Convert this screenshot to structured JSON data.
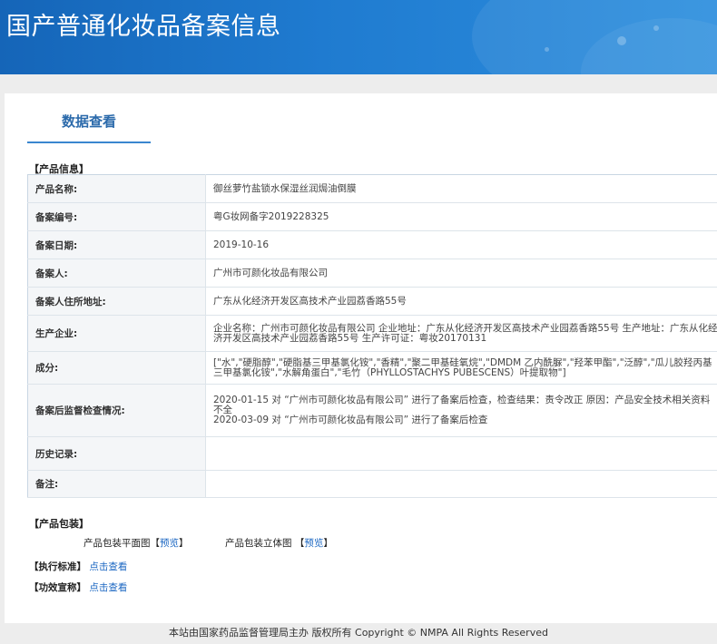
{
  "header": {
    "title": "国产普通化妆品备案信息"
  },
  "tab": {
    "label": "数据查看"
  },
  "product_info": {
    "section_title": "【产品信息】",
    "rows": [
      {
        "label": "产品名称:",
        "value": "御丝萝竹盐锁水保湿丝润焗油倒膜"
      },
      {
        "label": "备案编号:",
        "value": "粤G妆网备字2019228325"
      },
      {
        "label": "备案日期:",
        "value": "2019-10-16"
      },
      {
        "label": "备案人:",
        "value": "广州市可颜化妆品有限公司"
      },
      {
        "label": "备案人住所地址:",
        "value": "广东从化经济开发区高技术产业园荔香路55号"
      },
      {
        "label": "生产企业:",
        "value": "企业名称：广州市可颜化妆品有限公司 企业地址：广东从化经济开发区高技术产业园荔香路55号 生产地址：广东从化经济开发区高技术产业园荔香路55号 生产许可证：粤妆20170131"
      },
      {
        "label": "成分:",
        "value": "[\"水\",\"硬脂醇\",\"硬脂基三甲基氯化铵\",\"香精\",\"聚二甲基硅氧烷\",\"DMDM 乙内酰脲\",\"羟苯甲酯\",\"泛醇\",\"瓜儿胶羟丙基三甲基氯化铵\",\"水解角蛋白\",\"毛竹（PHYLLOSTACHYS PUBESCENS）叶提取物\"]"
      },
      {
        "label": "备案后监督检查情况:",
        "value_lines": [
          "2020-01-15 对 “广州市可颜化妆品有限公司” 进行了备案后检查，检查结果：责令改正 原因：产品安全技术相关资料不全",
          "2020-03-09 对 “广州市可颜化妆品有限公司” 进行了备案后检查"
        ]
      },
      {
        "label": "历史记录:",
        "value": ""
      },
      {
        "label": "备注:",
        "value": ""
      }
    ]
  },
  "packaging": {
    "section_title": "【产品包装】",
    "flat_label": "产品包装平面图",
    "solid_label": "产品包装立体图",
    "preview_link": "预览"
  },
  "standards": {
    "label": "【执行标准】",
    "link": "点击查看"
  },
  "efficacy": {
    "label": "【功效宣称】",
    "link": "点击查看"
  },
  "footer": {
    "text": "本站由国家药品监督管理局主办 版权所有 Copyright © NMPA All Rights Reserved"
  }
}
